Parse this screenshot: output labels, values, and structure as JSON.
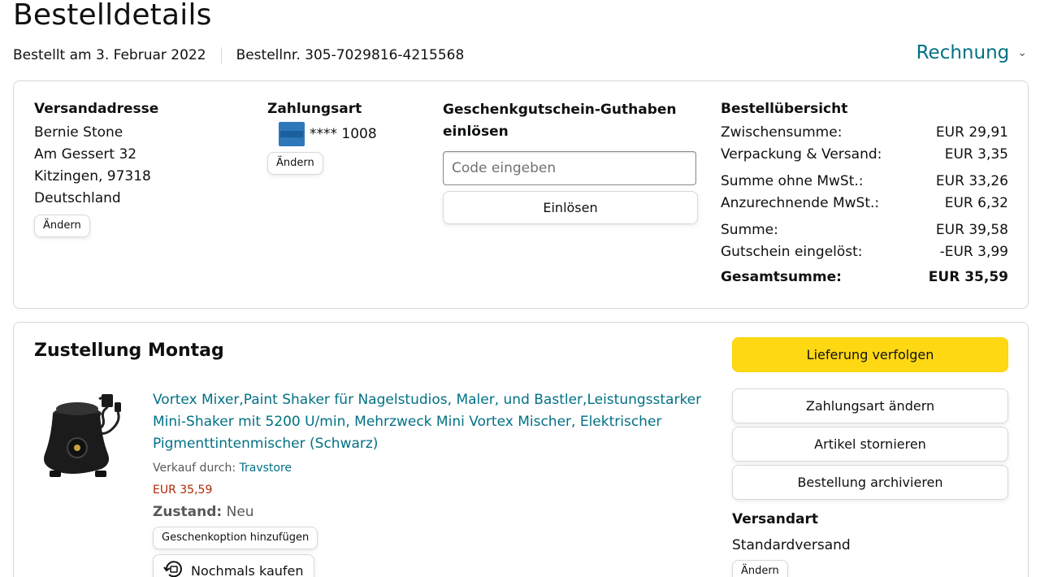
{
  "header": {
    "title": "Bestelldetails",
    "ordered_on": "Bestellt am 3. Februar 2022",
    "order_number": "Bestellnr. 305-7029816-4215568",
    "invoice_label": "Rechnung"
  },
  "shipping": {
    "title": "Versandadresse",
    "lines": [
      "Bernie Stone",
      "Am Gessert 32",
      "Kitzingen, 97318",
      "Deutschland"
    ],
    "change_label": "Ändern"
  },
  "payment": {
    "title": "Zahlungsart",
    "card_masked": "**** 1008",
    "card_icon": "amex-card-icon",
    "change_label": "Ändern"
  },
  "gift_card": {
    "title_line1": "Geschenkgutschein-Guthaben",
    "title_line2": "einlösen",
    "placeholder": "Code eingeben",
    "redeem_label": "Einlösen"
  },
  "summary": {
    "title": "Bestellübersicht",
    "rows": [
      {
        "label": "Zwischensumme:",
        "value": "EUR 29,91"
      },
      {
        "label": "Verpackung & Versand:",
        "value": "EUR 3,35"
      },
      {
        "label": "Summe ohne MwSt.:",
        "value": "EUR 33,26"
      },
      {
        "label": "Anzurechnende MwSt.:",
        "value": "EUR 6,32"
      },
      {
        "label": "Summe:",
        "value": "EUR 39,58"
      },
      {
        "label": "Gutschein eingelöst:",
        "value": "-EUR 3,99"
      }
    ],
    "total_label": "Gesamtsumme:",
    "total_value": "EUR 35,59"
  },
  "delivery": {
    "title": "Zustellung Montag",
    "product": {
      "title": "Vortex Mixer,Paint Shaker für Nagelstudios, Maler, und Bastler,Leistungsstarker Mini-Shaker mit 5200 U/min, Mehrzweck Mini Vortex Mischer, Elektrischer Pigmenttintenmischer (Schwarz)",
      "sold_by_label": "Verkauf durch:",
      "seller": "Travstore",
      "price": "EUR 35,59",
      "condition_label": "Zustand:",
      "condition_value": "Neu",
      "gift_option_label": "Geschenkoption hinzufügen",
      "buy_again_label": "Nochmals kaufen"
    },
    "actions": {
      "track": "Lieferung verfolgen",
      "change_payment": "Zahlungsart ändern",
      "cancel_items": "Artikel stornieren",
      "archive_order": "Bestellung archivieren"
    },
    "shipping_method_title": "Versandart",
    "shipping_method_value": "Standardversand",
    "shipping_method_change": "Ändern"
  },
  "colors": {
    "link": "#007185",
    "primary_button": "#ffd814",
    "price": "#b12704",
    "border": "#d5d9d9"
  }
}
